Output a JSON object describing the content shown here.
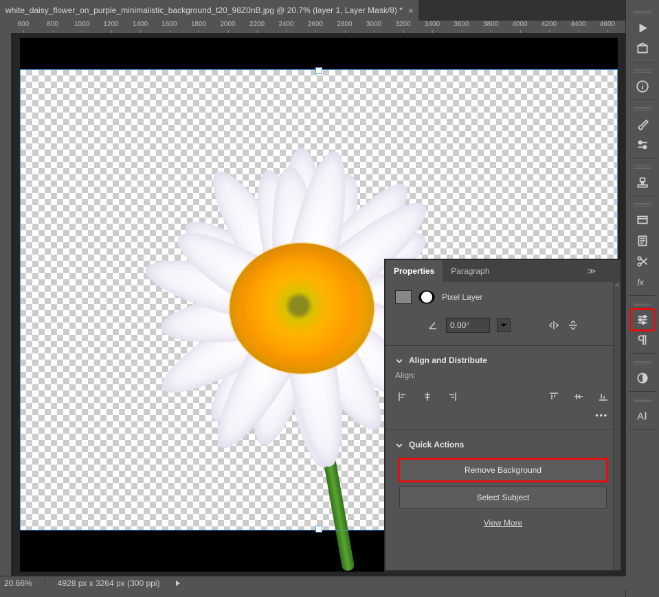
{
  "document": {
    "tab_title": "white_daisy_flower_on_purple_minimalistic_background_t20_98Z0nB.jpg @ 20.7% (layer 1, Layer Mask/8) *"
  },
  "ruler": {
    "ticks": [
      "600",
      "800",
      "1000",
      "1200",
      "1400",
      "1600",
      "1800",
      "2000",
      "2200",
      "2400",
      "2600",
      "2800",
      "3000",
      "3200",
      "3400",
      "3600",
      "3800",
      "4000",
      "4200",
      "4400",
      "4600"
    ]
  },
  "panel": {
    "tabs": {
      "properties": "Properties",
      "paragraph": "Paragraph"
    },
    "layer_type": "Pixel Layer",
    "angle_value": "0.00°",
    "align_header": "Align and Distribute",
    "align_label": "Align:",
    "more": "•••",
    "quick_header": "Quick Actions",
    "remove_bg": "Remove Background",
    "select_subject": "Select Subject",
    "view_more": "View More"
  },
  "status": {
    "zoom": "20.66%",
    "dims": "4928 px x 3264 px (300 ppi)"
  },
  "dock_icons": [
    "play",
    "art",
    "info",
    "brush",
    "sliders-h",
    "stamp",
    "screens",
    "notes",
    "scissors",
    "fx",
    "adjust",
    "paragraph",
    "contrast",
    "character"
  ]
}
